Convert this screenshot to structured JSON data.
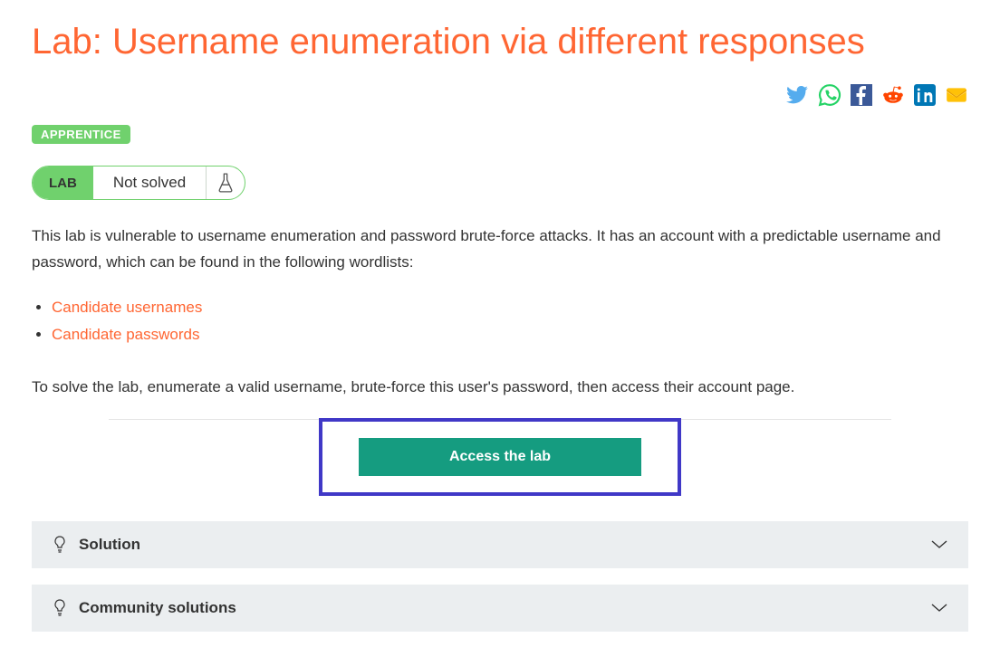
{
  "title": "Lab: Username enumeration via different responses",
  "difficulty": "APPRENTICE",
  "status": {
    "label": "LAB",
    "state": "Not solved"
  },
  "intro": "This lab is vulnerable to username enumeration and password brute-force attacks. It has an account with a predictable username and password, which can be found in the following wordlists:",
  "links": [
    {
      "label": "Candidate usernames"
    },
    {
      "label": "Candidate passwords"
    }
  ],
  "instruction": "To solve the lab, enumerate a valid username, brute-force this user's password, then access their account page.",
  "cta": "Access the lab",
  "accordions": [
    {
      "title": "Solution"
    },
    {
      "title": "Community solutions"
    }
  ],
  "share": {
    "twitter": "twitter-icon",
    "whatsapp": "whatsapp-icon",
    "facebook": "facebook-icon",
    "reddit": "reddit-icon",
    "linkedin": "linkedin-icon",
    "email": "email-icon"
  }
}
